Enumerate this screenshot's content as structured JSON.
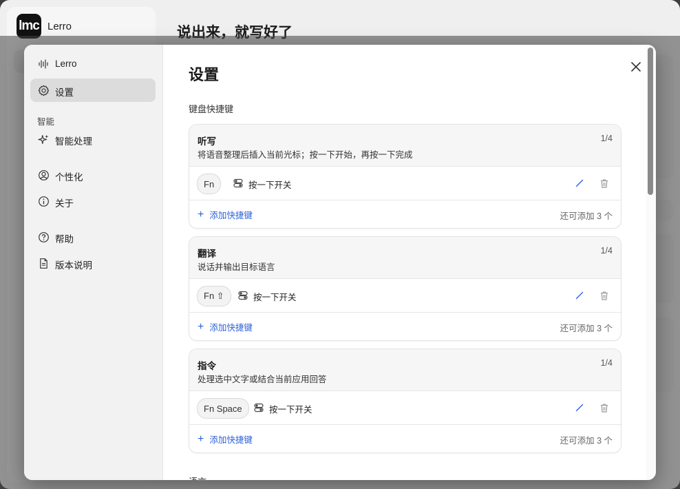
{
  "background": {
    "app_name": "Lerro",
    "logo_text": "lmc",
    "headline": "说出来，就写好了"
  },
  "sidebar": {
    "items": [
      {
        "label": "Lerro",
        "icon": "waveform-icon"
      },
      {
        "label": "设置",
        "icon": "gear-icon",
        "active": true
      }
    ],
    "section_title": "智能",
    "items2": [
      {
        "label": "智能处理",
        "icon": "sparkle-icon"
      },
      {
        "label": "个性化",
        "icon": "user-circle-icon"
      },
      {
        "label": "关于",
        "icon": "info-icon"
      },
      {
        "label": "帮助",
        "icon": "help-icon"
      },
      {
        "label": "版本说明",
        "icon": "document-icon"
      }
    ]
  },
  "main": {
    "title": "设置",
    "section_label": "键盘快捷键",
    "next_section_label": "语言",
    "cards": [
      {
        "title": "听写",
        "description": "将语音整理后插入当前光标；按一下开始，再按一下完成",
        "count": "1/4",
        "shortcut": {
          "key": "Fn",
          "mode": "按一下开关"
        },
        "add_label": "添加快捷键",
        "remaining": "还可添加 3 个"
      },
      {
        "title": "翻译",
        "description": "说话并输出目标语言",
        "count": "1/4",
        "shortcut": {
          "key": "Fn ⇧",
          "mode": "按一下开关"
        },
        "add_label": "添加快捷键",
        "remaining": "还可添加 3 个"
      },
      {
        "title": "指令",
        "description": "处理选中文字或结合当前应用回答",
        "count": "1/4",
        "shortcut": {
          "key": "Fn Space",
          "mode": "按一下开关"
        },
        "add_label": "添加快捷键",
        "remaining": "还可添加 3 个"
      }
    ]
  },
  "colors": {
    "accent": "#2f62d8",
    "sidebar_bg": "#f2f2f2",
    "active_item_bg": "#dcdcdc"
  }
}
